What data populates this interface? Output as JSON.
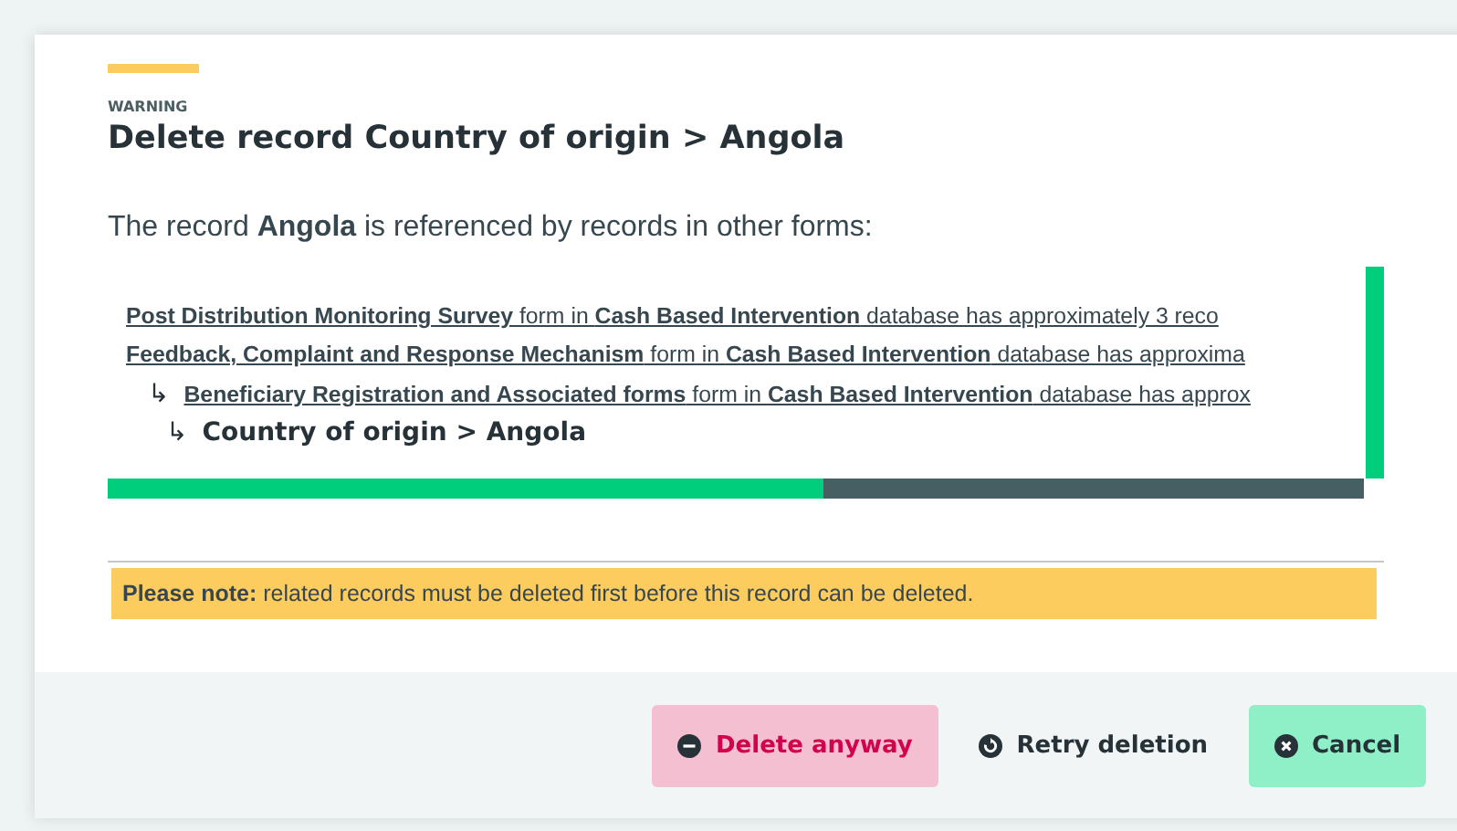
{
  "dialog": {
    "eyebrow": "WARNING",
    "title": "Delete record Country of origin > Angola",
    "intro": "The record **Angola** is referenced by records in other forms:",
    "references": [
      {
        "kind": "link",
        "text": "**Post Distribution Monitoring Survey** form in **Cash Based Intervention** database has approximately 3 reco"
      },
      {
        "kind": "link",
        "text": "**Feedback, Complaint and Response Mechanism** form in **Cash Based Intervention** database has approxima",
        "children": [
          {
            "kind": "link",
            "marker": "↳",
            "text": "**Beneficiary Registration and Associated forms** form in **Cash Based Intervention** database has approx",
            "children": [
              {
                "kind": "record",
                "marker": "↳",
                "text": "Country of origin > Angola"
              }
            ]
          }
        ]
      }
    ],
    "note": "**Please note:** related records must be deleted first before this record can be deleted.",
    "buttons": [
      {
        "kind": "danger",
        "label": "Delete anyway"
      },
      {
        "kind": "plain",
        "label": "Retry deletion"
      },
      {
        "kind": "confirm",
        "label": "Cancel"
      }
    ]
  }
}
